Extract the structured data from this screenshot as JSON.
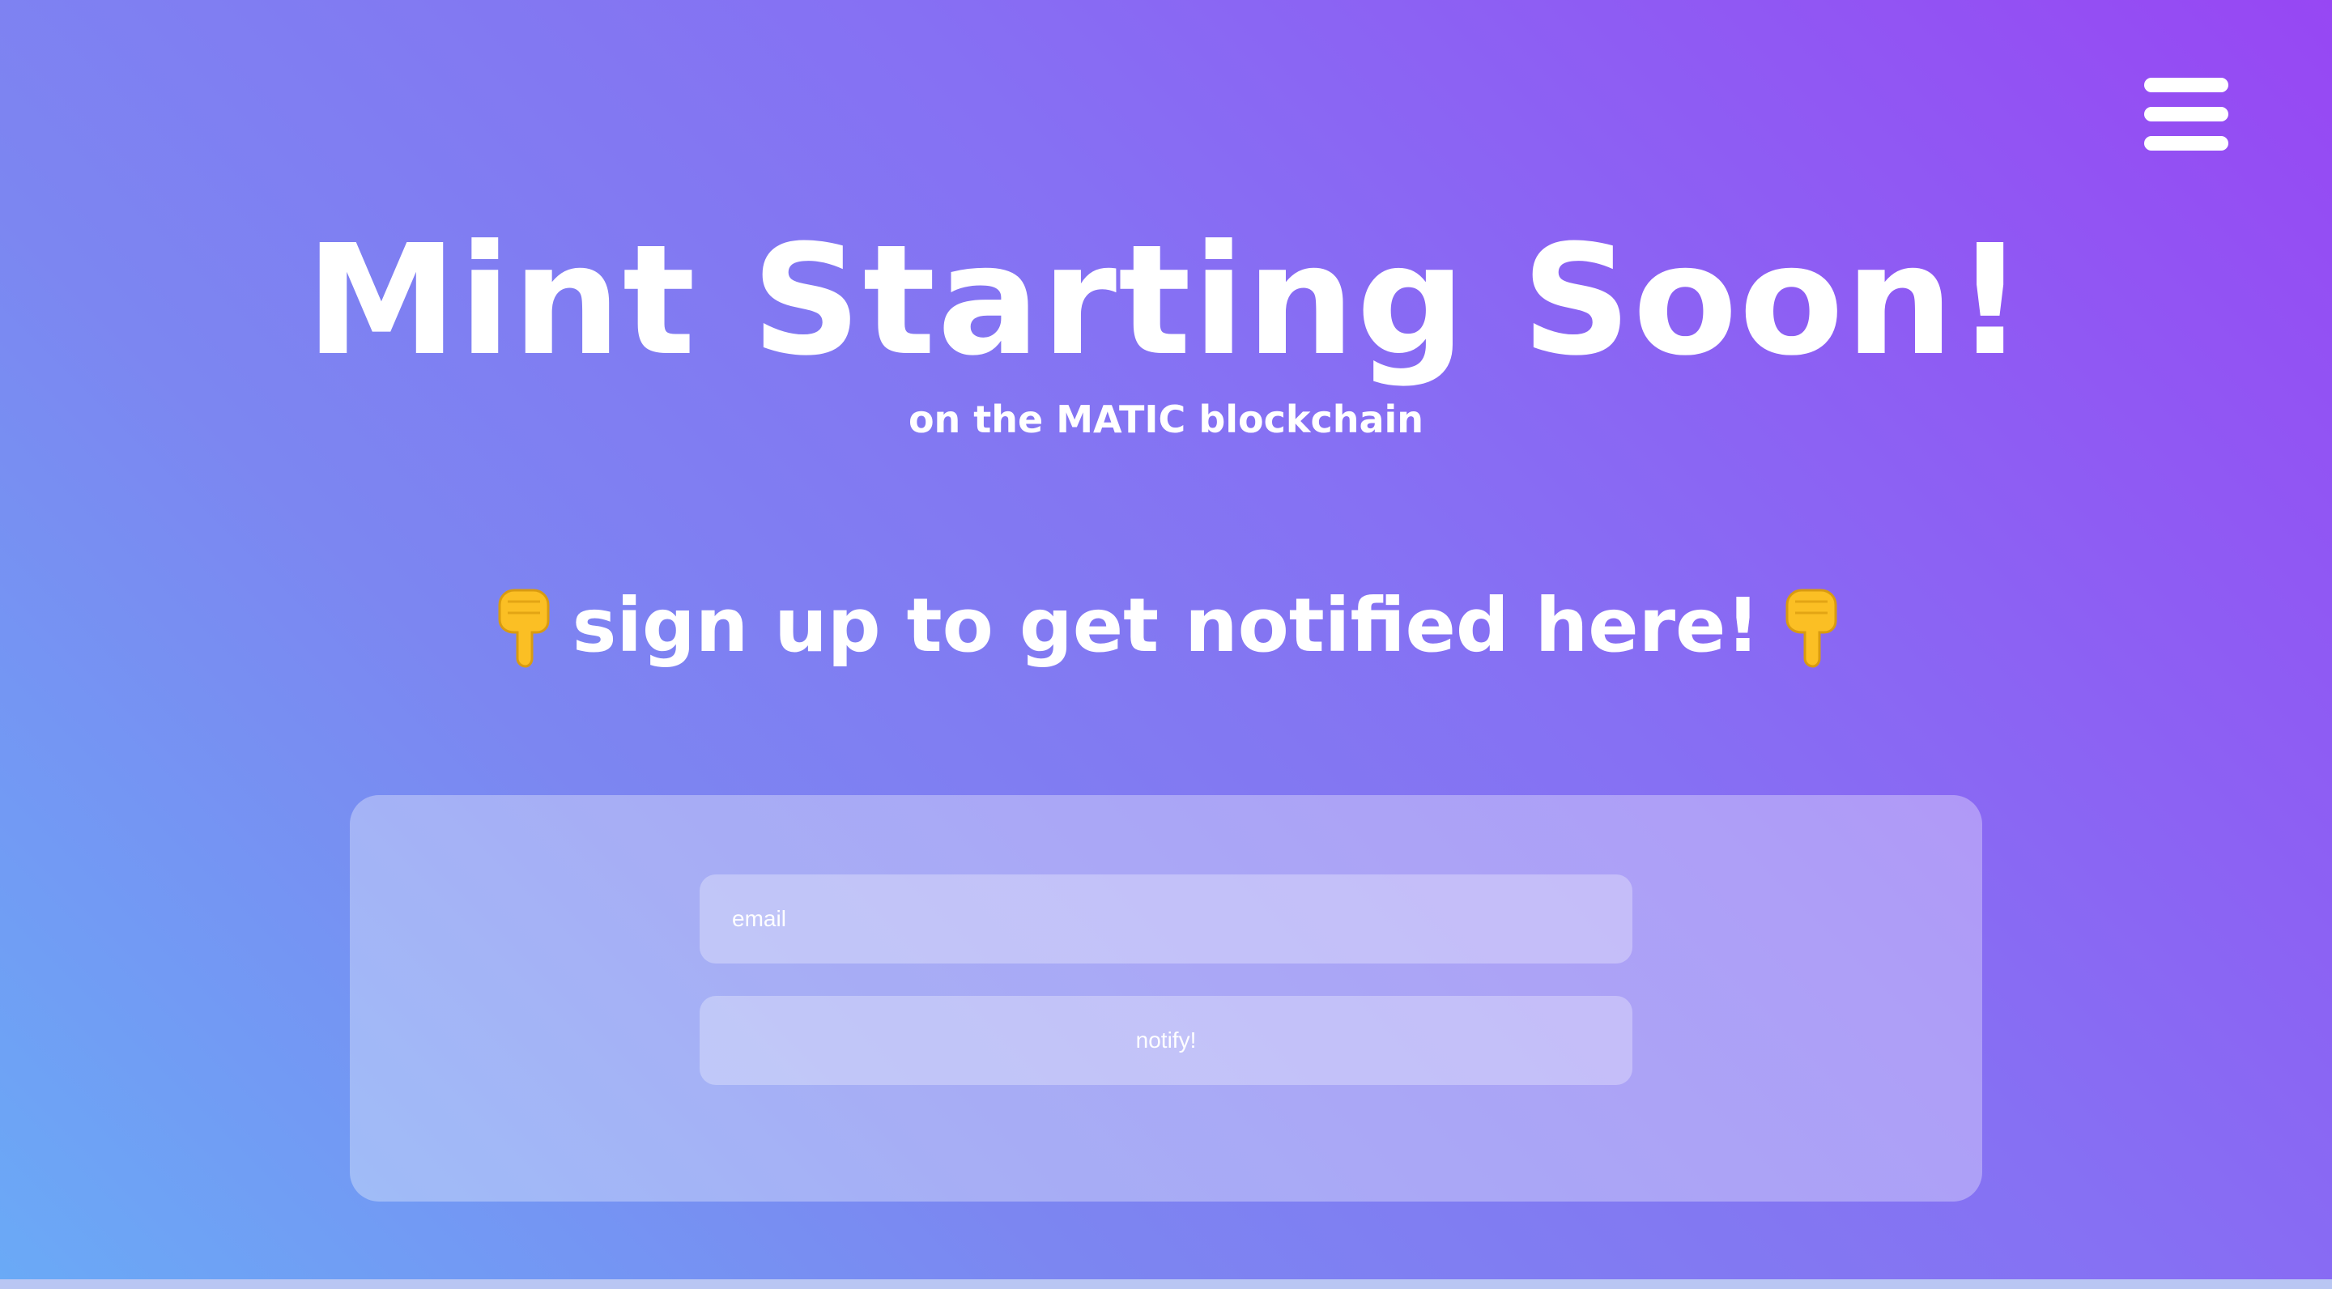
{
  "header": {
    "menu_icon": "hamburger-menu-icon"
  },
  "hero": {
    "title": "Mint Starting Soon!",
    "subtitle": "on the MATIC blockchain"
  },
  "signup": {
    "prompt": "sign up to get notified here!",
    "left_icon": "pointing-down-hand-icon",
    "right_icon": "pointing-down-hand-icon"
  },
  "form": {
    "email_placeholder": "email",
    "email_value": "",
    "submit_label": "notify!"
  },
  "colors": {
    "gradient_top_right": "#9747f3",
    "gradient_bottom_left": "#6aaaf6",
    "text": "#ffffff",
    "emoji_hand": "#fbbf24"
  }
}
